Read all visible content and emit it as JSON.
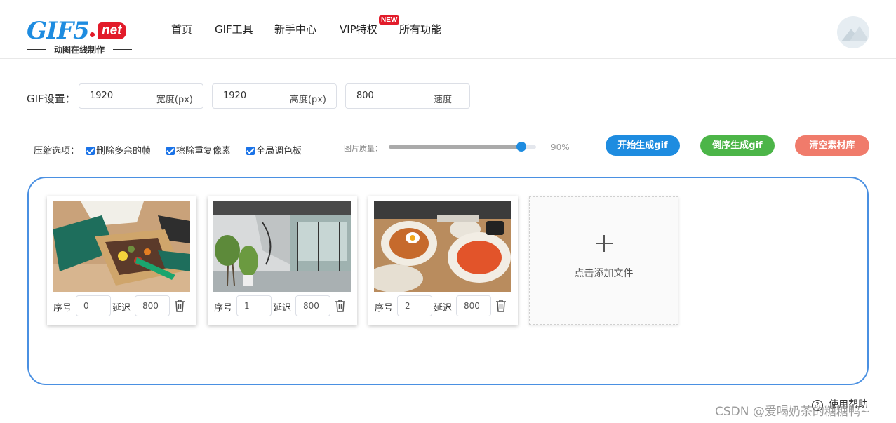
{
  "header": {
    "logo": {
      "main": "GIF5",
      "badge": "net",
      "tagline": "动图在线制作"
    },
    "nav": [
      {
        "label": "首页"
      },
      {
        "label": "GIF工具"
      },
      {
        "label": "新手中心"
      },
      {
        "label": "VIP特权"
      },
      {
        "label": "所有功能"
      }
    ],
    "new_badge": "NEW"
  },
  "settings": {
    "label": "GIF设置：",
    "width": {
      "value": "1920",
      "unit": "宽度(px)"
    },
    "height": {
      "value": "1920",
      "unit": "高度(px)"
    },
    "speed": {
      "value": "800",
      "unit": "速度"
    }
  },
  "compress": {
    "label": "压缩选项：",
    "options": [
      {
        "label": "删除多余的帧",
        "checked": true
      },
      {
        "label": "擦除重复像素",
        "checked": true
      },
      {
        "label": "全局调色板",
        "checked": true
      }
    ],
    "quality_label": "图片质量：",
    "quality_value": "90%",
    "quality_fraction": 0.9
  },
  "actions": {
    "generate": "开始生成gif",
    "reverse": "倒序生成gif",
    "clear": "清空素材库",
    "colors": {
      "generate": "#1e8ce0",
      "reverse": "#4cb548",
      "clear": "#f07b6b"
    }
  },
  "frames": [
    {
      "index_label": "序号",
      "index": "0",
      "delay_label": "延迟",
      "delay": "800",
      "image": "food-box-photo"
    },
    {
      "index_label": "序号",
      "index": "1",
      "delay_label": "延迟",
      "delay": "800",
      "image": "interior-plants-photo"
    },
    {
      "index_label": "序号",
      "index": "2",
      "delay_label": "延迟",
      "delay": "800",
      "image": "restaurant-table-photo"
    }
  ],
  "add_file": "点击添加文件",
  "help": {
    "icon": "?",
    "label": "使用帮助"
  },
  "watermark": "CSDN @爱喝奶茶的糖糖鸭~"
}
